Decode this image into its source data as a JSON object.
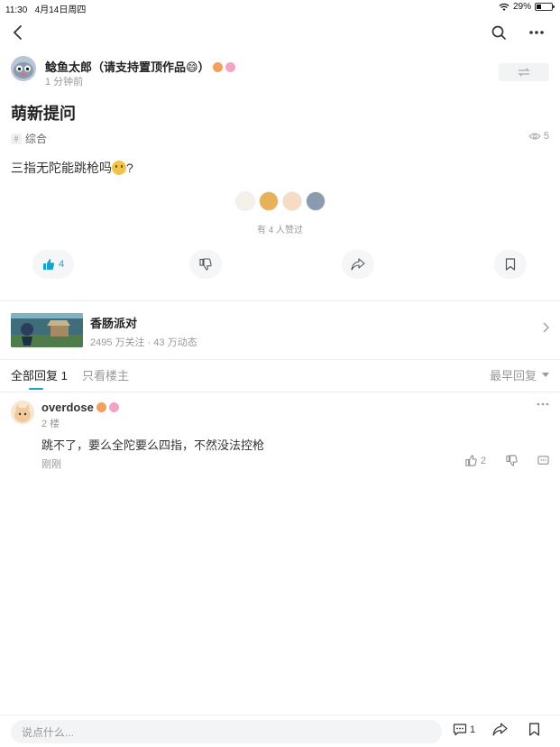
{
  "status_bar": {
    "time": "11:30",
    "date": "4月14日周四",
    "battery": "29%",
    "battery_level": 0.29
  },
  "navbar": {
    "back_icon": "back-arrow-icon",
    "search_icon": "search-icon",
    "more_icon": "more-dots-icon"
  },
  "author": {
    "name": "鲶鱼太郎（请支持置顶作品😄）",
    "time": "1 分钟前",
    "follow_icon": "swap-arrows-icon"
  },
  "post": {
    "title": "萌新提问",
    "topic": "综合",
    "topic_icon": "#",
    "views": "5",
    "body_before_emoji": "三指无陀能跳枪吗",
    "body_after_emoji": "?",
    "likers_text": "有 4 人赞过"
  },
  "actions": {
    "like_count": "4"
  },
  "game": {
    "name": "香肠派对",
    "meta": "2495 万关注 · 43 万动态"
  },
  "tabs": {
    "all_replies": "全部回复",
    "all_replies_count": "1",
    "op_only": "只看楼主",
    "sort_label": "最早回复"
  },
  "reply": {
    "name": "overdose",
    "floor": "2 楼",
    "text": "跳不了，要么全陀要么四指，不然没法控枪",
    "time": "刚刚",
    "like_count": "2"
  },
  "bottom_bar": {
    "input_placeholder": "说点什么...",
    "comment_count": "1"
  },
  "colors": {
    "accent": "#1aa3c8",
    "muted": "#999999",
    "divider": "#eeeeee"
  }
}
